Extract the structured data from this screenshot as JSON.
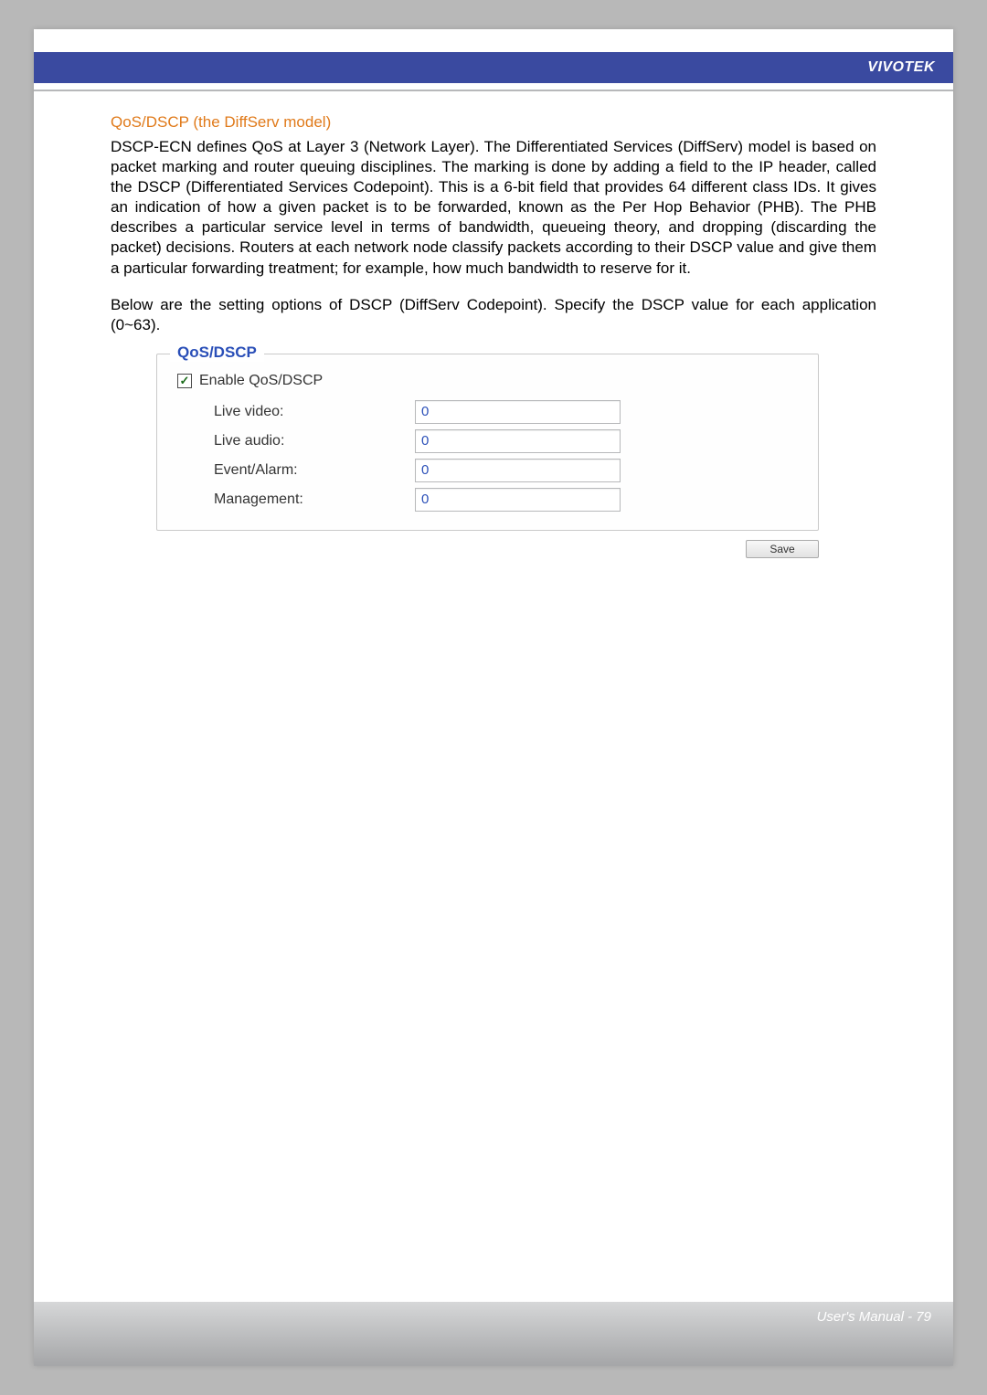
{
  "brand": "VIVOTEK",
  "section_title": "QoS/DSCP (the DiffServ model)",
  "paragraph1": "DSCP-ECN defines QoS at Layer 3 (Network Layer). The Differentiated Services (DiffServ) model is based on packet marking and router queuing disciplines. The marking is done by adding a field to the IP header, called the DSCP (Differentiated Services Codepoint). This is a 6-bit field that provides 64 different class IDs. It gives an indication of how a given packet is to be forwarded, known as the Per Hop Behavior (PHB). The PHB describes a particular service level in terms of bandwidth, queueing theory, and dropping (discarding the packet) decisions. Routers at each network node classify packets according to their DSCP value and give them a particular forwarding treatment; for example, how much bandwidth to reserve for it.",
  "paragraph2": "Below are the setting options of DSCP (DiffServ Codepoint). Specify the DSCP value for each application (0~63).",
  "form": {
    "legend": "QoS/DSCP",
    "enable_label": "Enable QoS/DSCP",
    "enable_checked": true,
    "rows": {
      "live_video": {
        "label": "Live video:",
        "value": "0"
      },
      "live_audio": {
        "label": "Live audio:",
        "value": "0"
      },
      "event_alarm": {
        "label": "Event/Alarm:",
        "value": "0"
      },
      "management": {
        "label": "Management:",
        "value": "0"
      }
    },
    "save_label": "Save"
  },
  "footer": "User's Manual - 79"
}
